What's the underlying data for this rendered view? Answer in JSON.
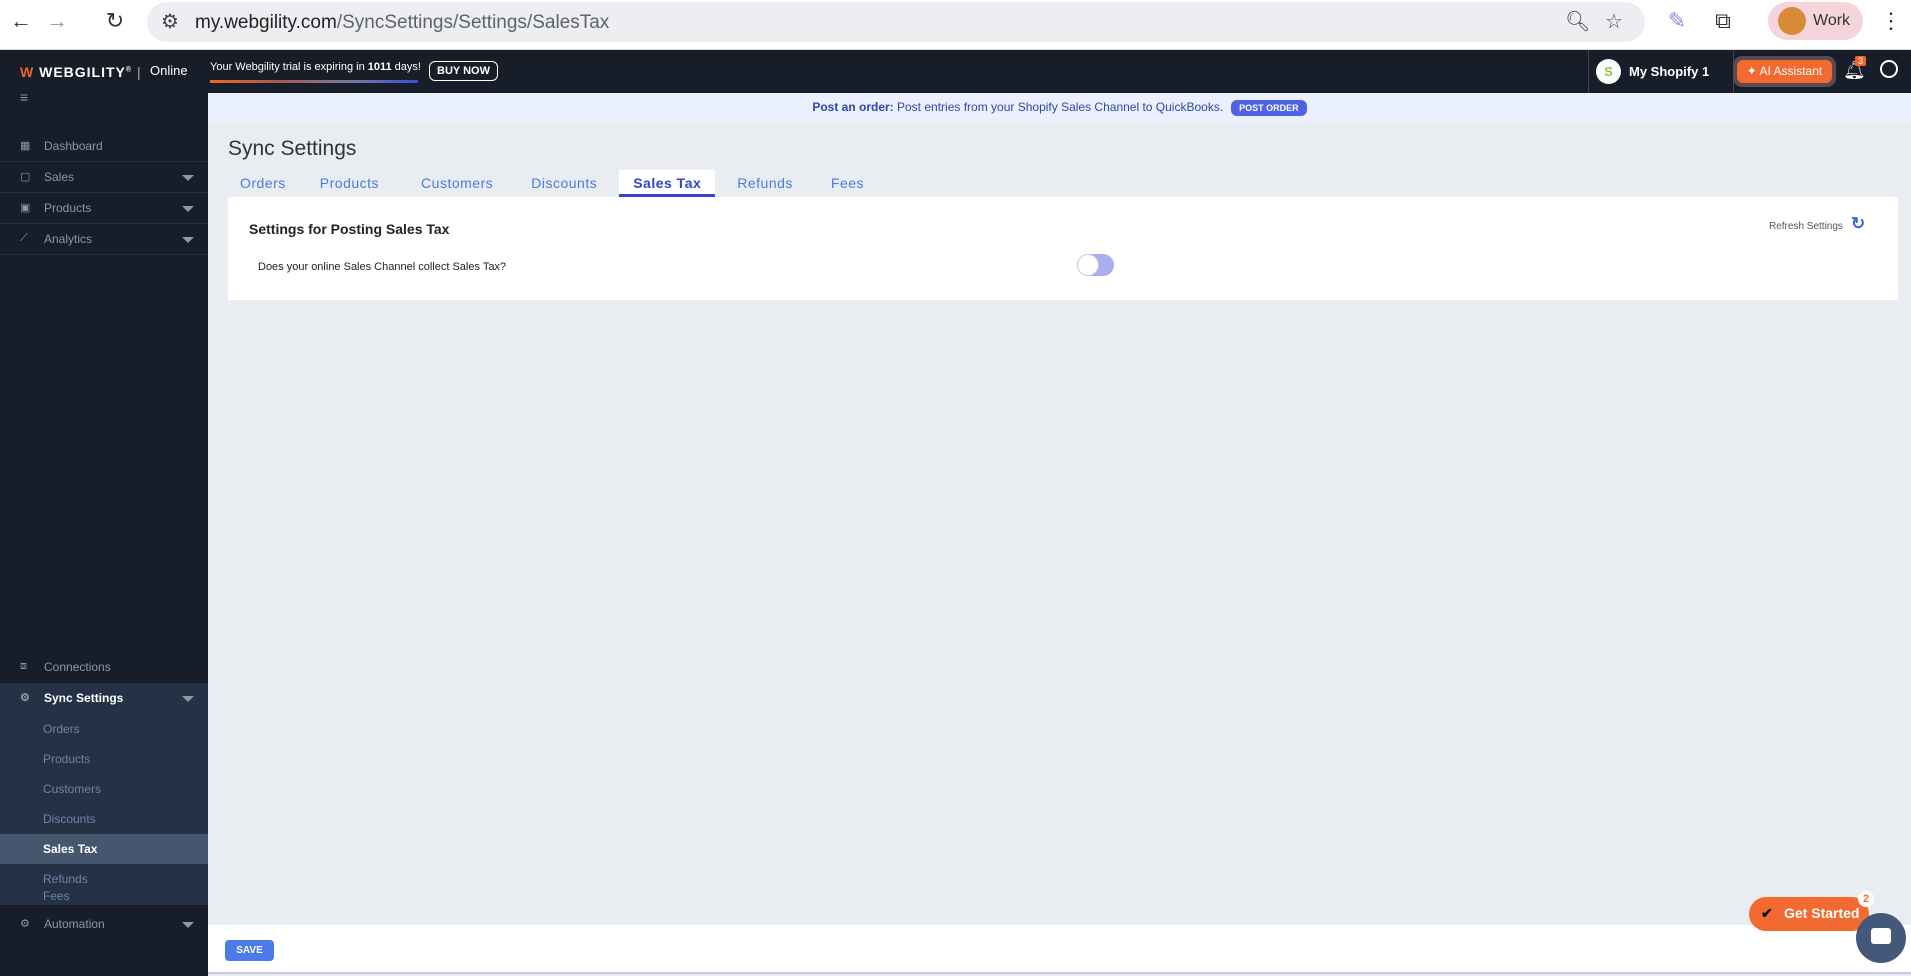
{
  "browser": {
    "url_host": "my.webgility.com",
    "url_path": "/SyncSettings/Settings/SalesTax",
    "profile": "Work"
  },
  "header": {
    "logo": "WEBGILITY",
    "edition": "Online",
    "trial_prefix": "Your Webgility trial is expiring in ",
    "trial_days": "1011",
    "trial_suffix": " days!",
    "buy_now": "BUY NOW",
    "store": "My Shopify 1",
    "ai_assistant": "AI Assistant",
    "notifications": "3"
  },
  "banner": {
    "label": "Post an order:",
    "text": " Post entries from your Shopify Sales Channel to QuickBooks.",
    "button": "POST ORDER"
  },
  "sidebar": {
    "items": [
      {
        "label": "Dashboard"
      },
      {
        "label": "Sales"
      },
      {
        "label": "Products"
      },
      {
        "label": "Analytics"
      },
      {
        "label": "Connections"
      },
      {
        "label": "Sync Settings"
      },
      {
        "label": "Automation"
      }
    ],
    "sub_items": [
      {
        "label": "Orders"
      },
      {
        "label": "Products"
      },
      {
        "label": "Customers"
      },
      {
        "label": "Discounts"
      },
      {
        "label": "Sales Tax"
      },
      {
        "label": "Refunds"
      },
      {
        "label": "Fees"
      }
    ]
  },
  "page": {
    "title": "Sync Settings",
    "tabs": [
      {
        "label": "Orders"
      },
      {
        "label": "Products"
      },
      {
        "label": "Customers"
      },
      {
        "label": "Discounts"
      },
      {
        "label": "Sales Tax"
      },
      {
        "label": "Refunds"
      },
      {
        "label": "Fees"
      }
    ],
    "active_tab": "Sales Tax"
  },
  "card": {
    "heading": "Settings for Posting Sales Tax",
    "refresh": "Refresh Settings",
    "question": "Does your online Sales Channel collect Sales Tax?",
    "toggle_on": false
  },
  "footer": {
    "save": "SAVE"
  },
  "widgets": {
    "get_started": "Get Started",
    "get_started_badge": "2"
  }
}
